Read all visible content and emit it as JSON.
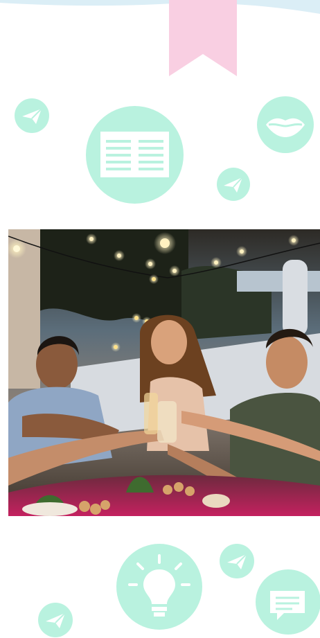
{
  "colors": {
    "accent_mint": "#b9f2df",
    "bookmark_pink": "#f9cfe2",
    "top_band": "#dbeef6"
  },
  "icons": {
    "top": [
      "bookmark-icon",
      "paper-plane-icon",
      "newspaper-icon",
      "smile-lips-icon",
      "paper-plane-icon"
    ],
    "bottom": [
      "paper-plane-icon",
      "lightbulb-icon",
      "chat-bubble-icon",
      "paper-plane-icon"
    ]
  },
  "photo": {
    "subject": "friends-toasting-at-dinner-party"
  }
}
